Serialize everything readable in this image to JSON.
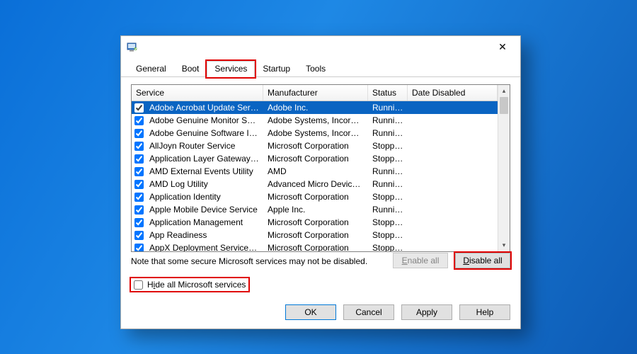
{
  "tabs": {
    "general": "General",
    "boot": "Boot",
    "services": "Services",
    "startup": "Startup",
    "tools": "Tools"
  },
  "columns": {
    "service": "Service",
    "manufacturer": "Manufacturer",
    "status": "Status",
    "date_disabled": "Date Disabled"
  },
  "rows": [
    {
      "name": "Adobe Acrobat Update Service",
      "mfr": "Adobe Inc.",
      "status": "Running",
      "checked": true,
      "selected": true
    },
    {
      "name": "Adobe Genuine Monitor Service",
      "mfr": "Adobe Systems, Incorpora...",
      "status": "Running",
      "checked": true
    },
    {
      "name": "Adobe Genuine Software Integri...",
      "mfr": "Adobe Systems, Incorpora...",
      "status": "Running",
      "checked": true
    },
    {
      "name": "AllJoyn Router Service",
      "mfr": "Microsoft Corporation",
      "status": "Stopped",
      "checked": true
    },
    {
      "name": "Application Layer Gateway Service",
      "mfr": "Microsoft Corporation",
      "status": "Stopped",
      "checked": true
    },
    {
      "name": "AMD External Events Utility",
      "mfr": "AMD",
      "status": "Running",
      "checked": true
    },
    {
      "name": "AMD Log Utility",
      "mfr": "Advanced Micro Devices, I...",
      "status": "Running",
      "checked": true
    },
    {
      "name": "Application Identity",
      "mfr": "Microsoft Corporation",
      "status": "Stopped",
      "checked": true
    },
    {
      "name": "Apple Mobile Device Service",
      "mfr": "Apple Inc.",
      "status": "Running",
      "checked": true
    },
    {
      "name": "Application Management",
      "mfr": "Microsoft Corporation",
      "status": "Stopped",
      "checked": true
    },
    {
      "name": "App Readiness",
      "mfr": "Microsoft Corporation",
      "status": "Stopped",
      "checked": true
    },
    {
      "name": "AppX Deployment Service (AppX...",
      "mfr": "Microsoft Corporation",
      "status": "Stopped",
      "checked": true
    }
  ],
  "note": "Note that some secure Microsoft services may not be disabled.",
  "buttons": {
    "enable_all": "Enable all",
    "disable_all": "Disable all",
    "ok": "OK",
    "cancel": "Cancel",
    "apply": "Apply",
    "help": "Help"
  },
  "hide_label_pre": "H",
  "hide_label_u": "i",
  "hide_label_post": "de all Microsoft services",
  "disable_pre": "",
  "disable_u": "D",
  "disable_post": "isable all",
  "enable_pre": "",
  "enable_u": "E",
  "enable_post": "nable all"
}
